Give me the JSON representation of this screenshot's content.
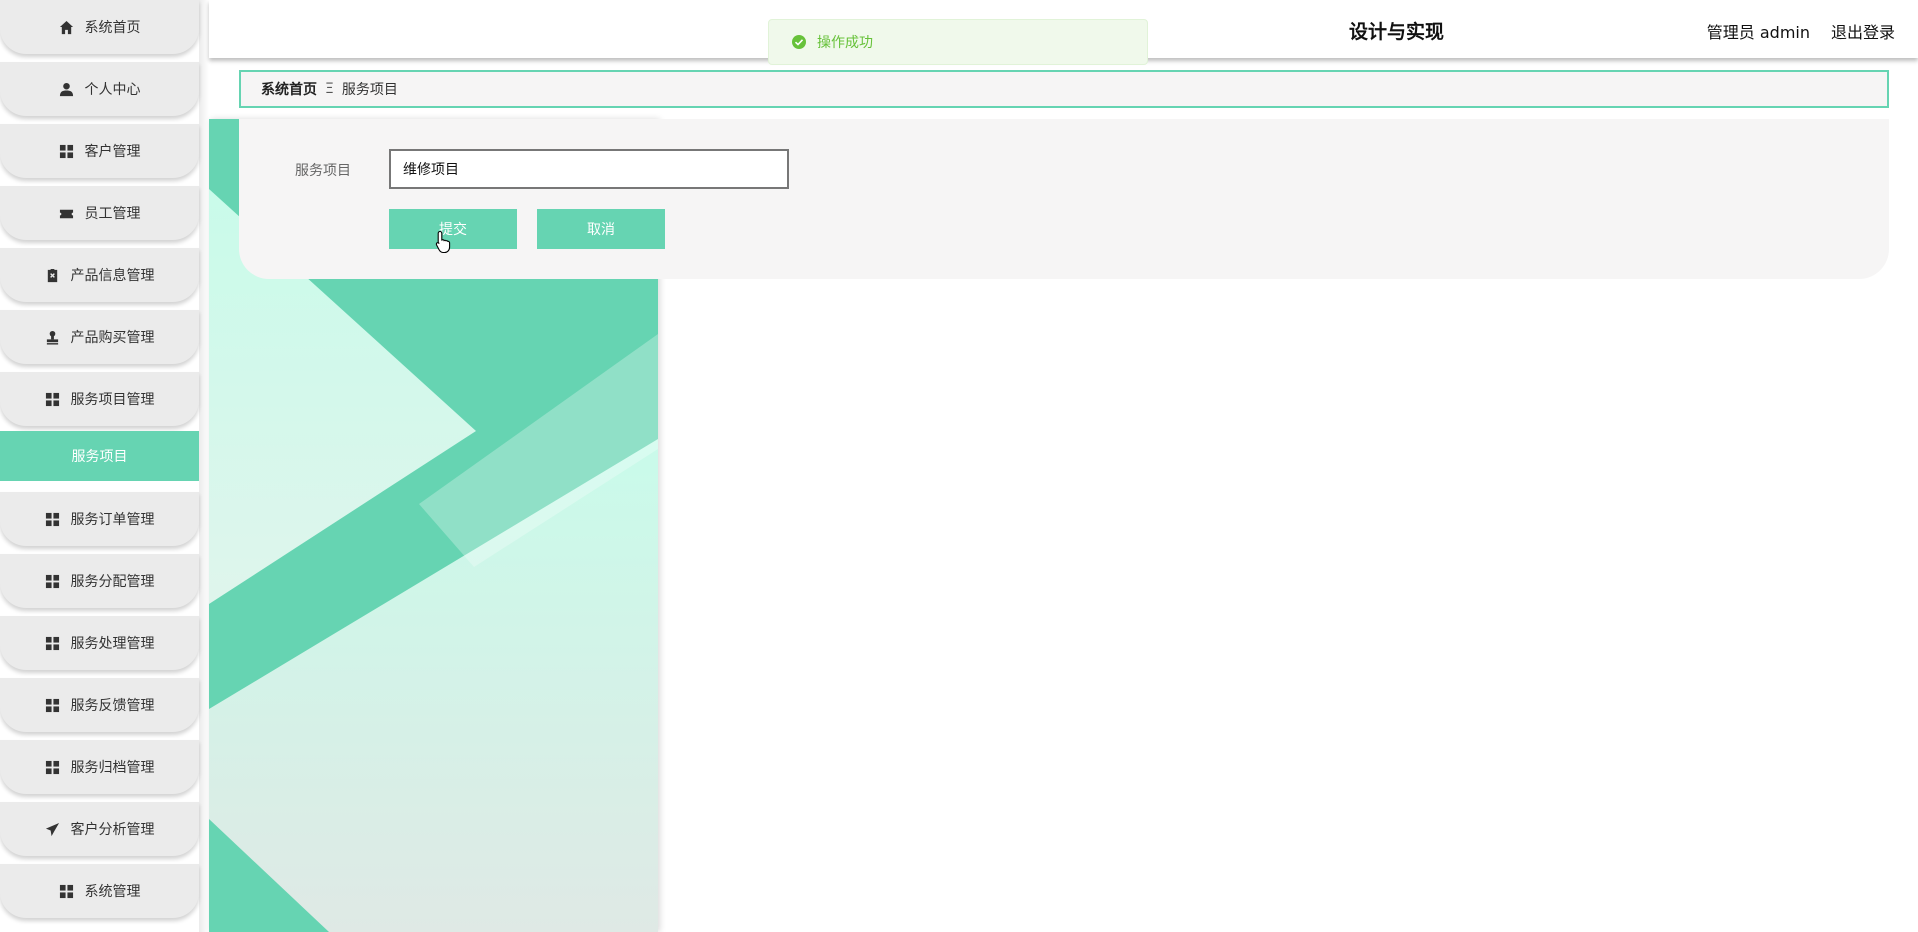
{
  "sidebar": {
    "items": [
      {
        "label": "系统首页",
        "icon": "home-icon"
      },
      {
        "label": "个人中心",
        "icon": "user-icon"
      },
      {
        "label": "客户管理",
        "icon": "grid-icon"
      },
      {
        "label": "员工管理",
        "icon": "ticket-icon"
      },
      {
        "label": "产品信息管理",
        "icon": "clipboard-icon"
      },
      {
        "label": "产品购买管理",
        "icon": "stamp-icon"
      },
      {
        "label": "服务项目管理",
        "icon": "grid-icon"
      },
      {
        "label": "服务订单管理",
        "icon": "grid-icon"
      },
      {
        "label": "服务分配管理",
        "icon": "grid-icon"
      },
      {
        "label": "服务处理管理",
        "icon": "grid-icon"
      },
      {
        "label": "服务反馈管理",
        "icon": "grid-icon"
      },
      {
        "label": "服务归档管理",
        "icon": "grid-icon"
      },
      {
        "label": "客户分析管理",
        "icon": "paper-plane-icon"
      },
      {
        "label": "系统管理",
        "icon": "grid-icon"
      }
    ],
    "active_submenu": "服务项目"
  },
  "header": {
    "title": "设计与实现",
    "user": "管理员 admin",
    "logout": "退出登录"
  },
  "toast": {
    "message": "操作成功",
    "color": "#67c23a"
  },
  "breadcrumb": {
    "home": "系统首页",
    "separator": "Ξ",
    "current": "服务项目"
  },
  "form": {
    "label": "服务项目",
    "value": "维修项目",
    "submit_label": "提交",
    "cancel_label": "取消"
  },
  "colors": {
    "accent": "#66d4b2",
    "panel": "#f6f5f5"
  }
}
